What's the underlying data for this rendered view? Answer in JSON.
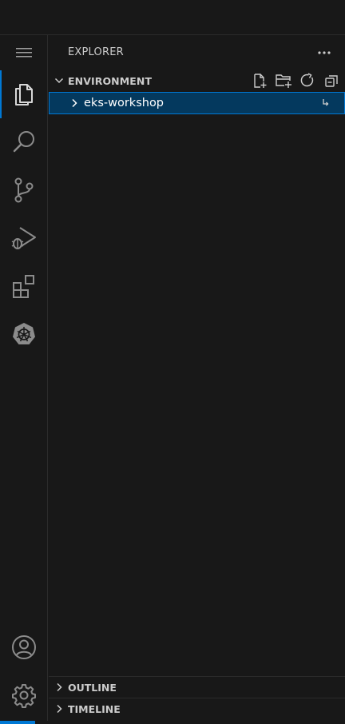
{
  "explorer": {
    "title": "EXPLORER"
  },
  "workspace": {
    "section_label": "ENVIRONMENT",
    "folders": [
      {
        "name": "eks-workshop"
      }
    ]
  },
  "bottom_sections": [
    {
      "label": "OUTLINE"
    },
    {
      "label": "TIMELINE"
    }
  ],
  "activity_bar": {
    "items": [
      "files-icon",
      "search-icon",
      "source-control-icon",
      "run-debug-icon",
      "extensions-icon",
      "kubernetes-icon"
    ],
    "bottom": [
      "account-icon",
      "gear-icon"
    ]
  },
  "colors": {
    "background": "#181818",
    "selection": "#04395e",
    "accent": "#0078d4"
  }
}
